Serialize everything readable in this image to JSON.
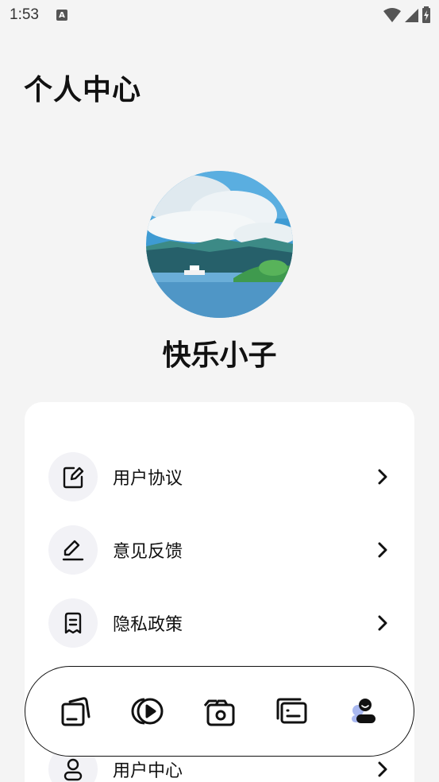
{
  "status": {
    "time": "1:53",
    "notif_letter": "A"
  },
  "page": {
    "title": "个人中心"
  },
  "profile": {
    "username": "快乐小子"
  },
  "menu": {
    "items": [
      {
        "label": "用户协议",
        "icon": "edit-document-icon"
      },
      {
        "label": "意见反馈",
        "icon": "pen-icon"
      },
      {
        "label": "隐私政策",
        "icon": "receipt-document-icon"
      },
      {
        "label": "用户中心",
        "icon": "user-icon"
      }
    ]
  },
  "tabs": [
    {
      "name": "files",
      "icon": "files-icon",
      "active": false
    },
    {
      "name": "video",
      "icon": "play-icon",
      "active": false
    },
    {
      "name": "camera",
      "icon": "camera-icon",
      "active": false
    },
    {
      "name": "messages",
      "icon": "message-cards-icon",
      "active": false
    },
    {
      "name": "profile",
      "icon": "profile-icon",
      "active": true
    }
  ],
  "colors": {
    "background": "#f4f4f4",
    "card": "#ffffff",
    "icon_bg": "#f2f2f6",
    "accent": "#a9b8f0"
  }
}
